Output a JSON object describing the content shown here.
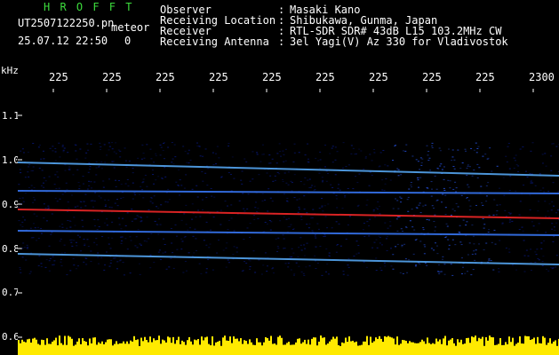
{
  "header": {
    "title": "H R O F F T",
    "filename": "UT2507122250.pn",
    "tag": "meteor",
    "date_time": "25.07.12 22:50",
    "extra": "0"
  },
  "meta": [
    {
      "label": "Observer",
      "value": "Masaki Kano"
    },
    {
      "label": "Receiving Location",
      "value": "Shibukawa, Gunma, Japan"
    },
    {
      "label": "Receiver",
      "value": "RTL-SDR SDR# 43dB L15 103.2MHz CW"
    },
    {
      "label": "Receiving Antenna",
      "value": "3el Yagi(V) Az 330 for Vladivostok"
    }
  ],
  "spectrogram": {
    "y_unit": "kHz",
    "y_ticks": [
      "1.1",
      "1.0",
      "0.9",
      "0.8",
      "0.7",
      "0.6"
    ],
    "x_ticks": [
      "225",
      "225",
      "225",
      "225",
      "225",
      "225",
      "225",
      "225",
      "225",
      "2300"
    ],
    "colors": {
      "background": "#000000",
      "noise": "#0a1c8c",
      "signal": "#ff2a2a",
      "baseline": "#ffea00",
      "label_green": "#3ddc3d"
    }
  }
}
